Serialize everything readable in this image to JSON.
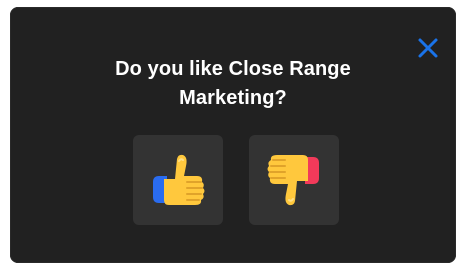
{
  "dialog": {
    "title_line1": "Do you like Close Range",
    "title_line2": "Marketing?",
    "close_icon": "close-icon",
    "buttons": [
      {
        "name": "thumbs-up-button",
        "icon": "thumbs-up-icon"
      },
      {
        "name": "thumbs-down-button",
        "icon": "thumbs-down-icon"
      }
    ]
  },
  "colors": {
    "dialog_bg": "#212121",
    "button_bg": "#333333",
    "accent": "#1a73e8",
    "thumb_yellow": "#ffc83d",
    "thumb_blue": "#2a6cf0",
    "thumb_red": "#f23a5a"
  }
}
